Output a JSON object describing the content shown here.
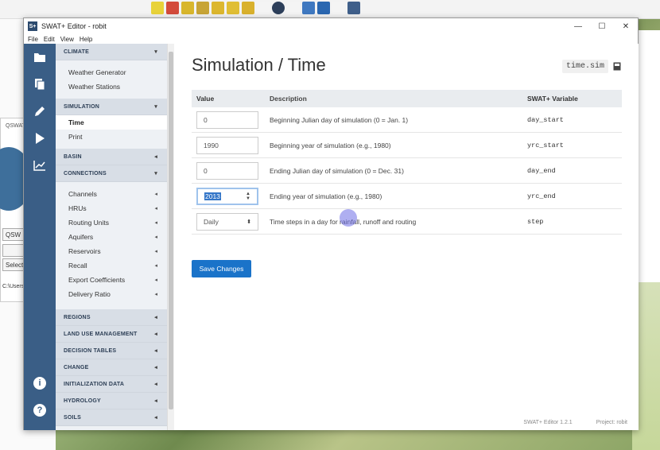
{
  "window": {
    "title": "SWAT+ Editor - robit",
    "app_icon_text": "S+",
    "controls": {
      "minimize": "—",
      "maximize": "☐",
      "close": "✕"
    }
  },
  "menu": [
    "File",
    "Edit",
    "View",
    "Help"
  ],
  "rail_icons": [
    "folder-icon",
    "copy-icon",
    "edit-icon",
    "play-icon",
    "chart-icon",
    "info-icon",
    "help-icon"
  ],
  "nav": {
    "climate": {
      "label": "CLIMATE",
      "items": [
        "Weather Generator",
        "Weather Stations"
      ]
    },
    "simulation": {
      "label": "SIMULATION",
      "items": [
        "Time",
        "Print"
      ]
    },
    "basin": {
      "label": "BASIN"
    },
    "connections": {
      "label": "CONNECTIONS",
      "items": [
        "Channels",
        "HRUs",
        "Routing Units",
        "Aquifers",
        "Reservoirs",
        "Recall",
        "Export Coefficients",
        "Delivery Ratio"
      ]
    },
    "regions": {
      "label": "REGIONS"
    },
    "land_use": {
      "label": "LAND USE MANAGEMENT"
    },
    "decision_tables": {
      "label": "DECISION TABLES"
    },
    "change": {
      "label": "CHANGE"
    },
    "init_data": {
      "label": "INITIALIZATION DATA"
    },
    "hydrology": {
      "label": "HYDROLOGY"
    },
    "soils": {
      "label": "SOILS"
    }
  },
  "page": {
    "title": "Simulation / Time",
    "file": "time.sim"
  },
  "table": {
    "headers": [
      "Value",
      "Description",
      "SWAT+ Variable"
    ],
    "rows": [
      {
        "value": "0",
        "description": "Beginning Julian day of simulation (0 = Jan. 1)",
        "variable": "day_start"
      },
      {
        "value": "1990",
        "description": "Beginning year of simulation (e.g., 1980)",
        "variable": "yrc_start"
      },
      {
        "value": "0",
        "description": "Ending Julian day of simulation (0 = Dec. 31)",
        "variable": "day_end"
      },
      {
        "value": "2013",
        "description": "Ending year of simulation (e.g., 1980)",
        "variable": "yrc_end"
      },
      {
        "value": "Daily",
        "description": "Time steps in a day for rainfall, runoff and routing",
        "variable": "step"
      }
    ]
  },
  "save_button": "Save Changes",
  "footer": {
    "version": "SWAT+ Editor 1.2.1",
    "project": "Project: robit"
  },
  "background_panel": {
    "title": "QSWAT",
    "buttons": [
      "QSW",
      "",
      "Select"
    ],
    "path": "C:\\Users"
  },
  "colors": {
    "rail": "#3a5e86",
    "accent": "#1a73c9",
    "nav_bg": "#eef1f5"
  }
}
